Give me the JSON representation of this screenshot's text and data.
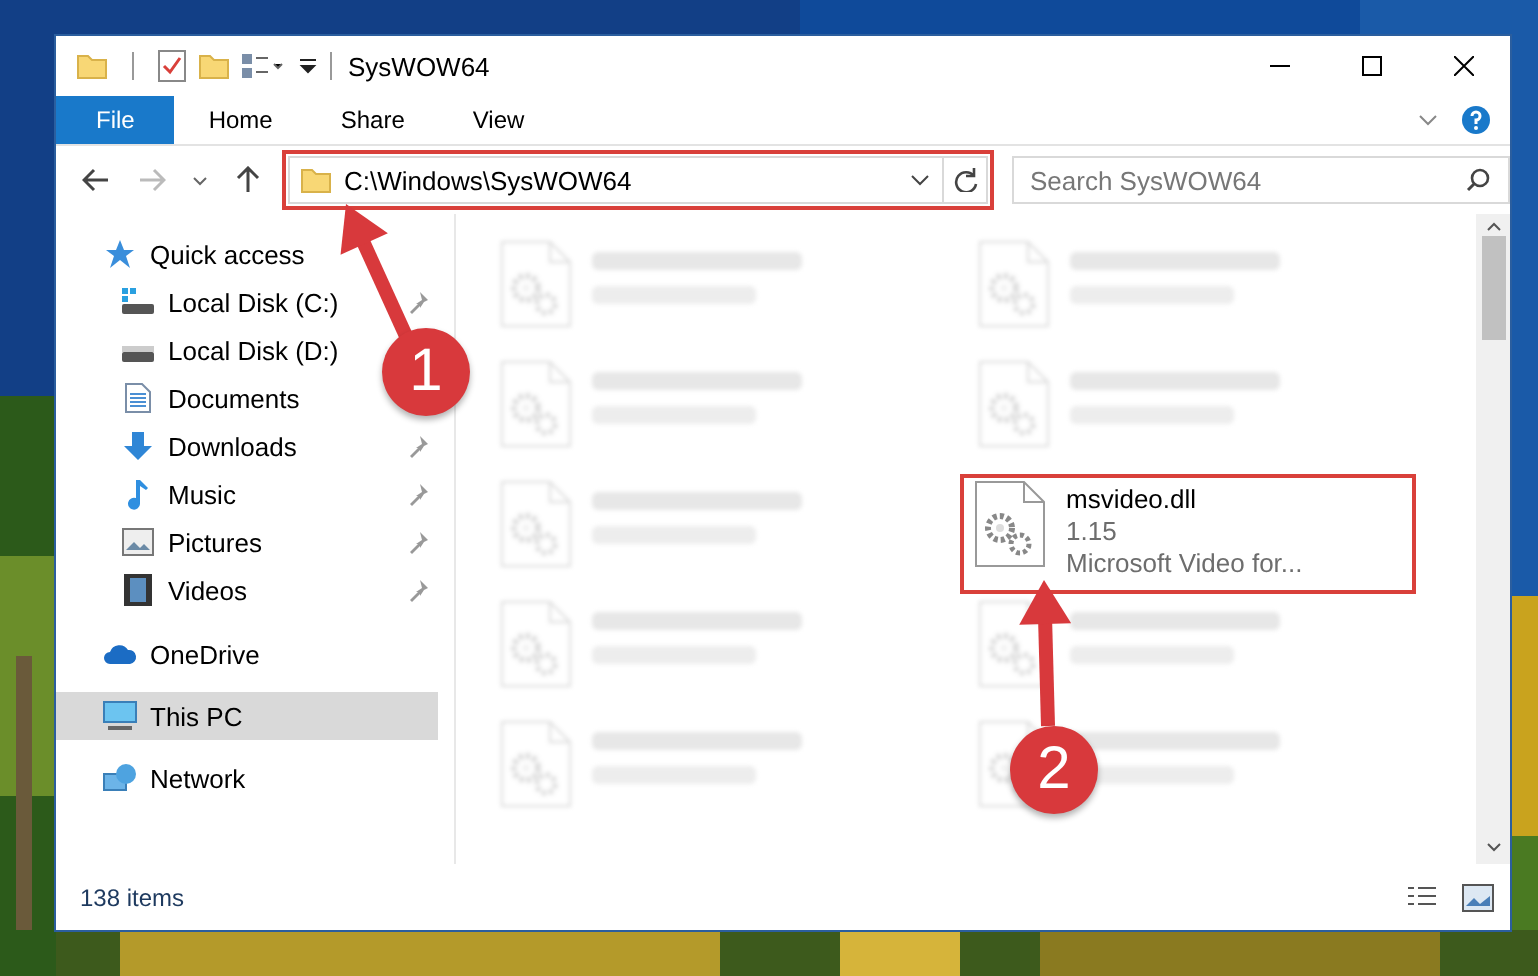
{
  "window": {
    "title": "SysWOW64"
  },
  "ribbon": {
    "tabs": [
      {
        "label": "File",
        "selected": true
      },
      {
        "label": "Home",
        "selected": false
      },
      {
        "label": "Share",
        "selected": false
      },
      {
        "label": "View",
        "selected": false
      }
    ]
  },
  "address_bar": {
    "path": "C:\\Windows\\SysWOW64",
    "boxed": true
  },
  "search": {
    "placeholder": "Search SysWOW64"
  },
  "sidebar": {
    "items": [
      {
        "label": "Quick access",
        "kind": "star",
        "selected": false,
        "children": [
          {
            "label": "Local Disk (C:)",
            "kind": "drive-c",
            "selected": false,
            "pinned": true
          },
          {
            "label": "Local Disk (D:)",
            "kind": "drive",
            "selected": false
          },
          {
            "label": "Documents",
            "kind": "documents",
            "selected": false
          },
          {
            "label": "Downloads",
            "kind": "downloads",
            "selected": false,
            "pinned": true
          },
          {
            "label": "Music",
            "kind": "music",
            "selected": false,
            "pinned": true
          },
          {
            "label": "Pictures",
            "kind": "pictures",
            "selected": false,
            "pinned": true
          },
          {
            "label": "Videos",
            "kind": "videos",
            "selected": false,
            "pinned": true
          }
        ]
      },
      {
        "label": "OneDrive",
        "kind": "cloud",
        "selected": false
      },
      {
        "label": "This PC",
        "kind": "pc",
        "selected": true
      },
      {
        "label": "Network",
        "kind": "network",
        "selected": false
      }
    ]
  },
  "files": [
    {
      "kind": "blurred"
    },
    {
      "kind": "blurred"
    },
    {
      "kind": "blurred"
    },
    {
      "kind": "blurred"
    },
    {
      "kind": "blurred"
    },
    {
      "kind": "file",
      "name": "msvideo.dll",
      "details": [
        "1.15",
        "Microsoft Video for..."
      ],
      "boxed": true
    },
    {
      "kind": "blurred"
    },
    {
      "kind": "blurred"
    },
    {
      "kind": "blurred"
    },
    {
      "kind": "blurred"
    }
  ],
  "callouts": [
    {
      "number": "1"
    },
    {
      "number": "2"
    }
  ],
  "status_bar": {
    "item_count": "138 items"
  }
}
